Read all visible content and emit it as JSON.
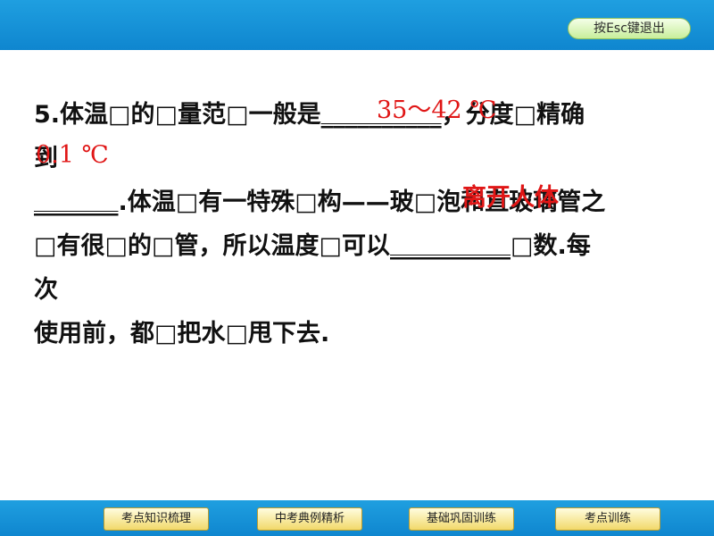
{
  "header": {
    "esc_label": "按Esc键退出"
  },
  "question": {
    "line1": "5.体温□的□量范□一般是",
    "line1_blank": "__________",
    "line1_after": "，分度□精确",
    "line2": "到",
    "line3_blank": "_______",
    "line3": ".体温□有一特殊□构——玻□泡和直玻璃管之",
    "line4": "□有很□的□管，所以温度□可以",
    "line4_blank": "__________",
    "line4_after": "□数.每",
    "line5": "次",
    "line6": "使用前，都□把水□甩下去."
  },
  "answers": {
    "range": "35～42 ℃",
    "precision": "0.1 ℃",
    "reading": "离开人体"
  },
  "nav": {
    "items": [
      "考点知识梳理",
      "中考典例精析",
      "基础巩固训练",
      "考点训练"
    ]
  }
}
